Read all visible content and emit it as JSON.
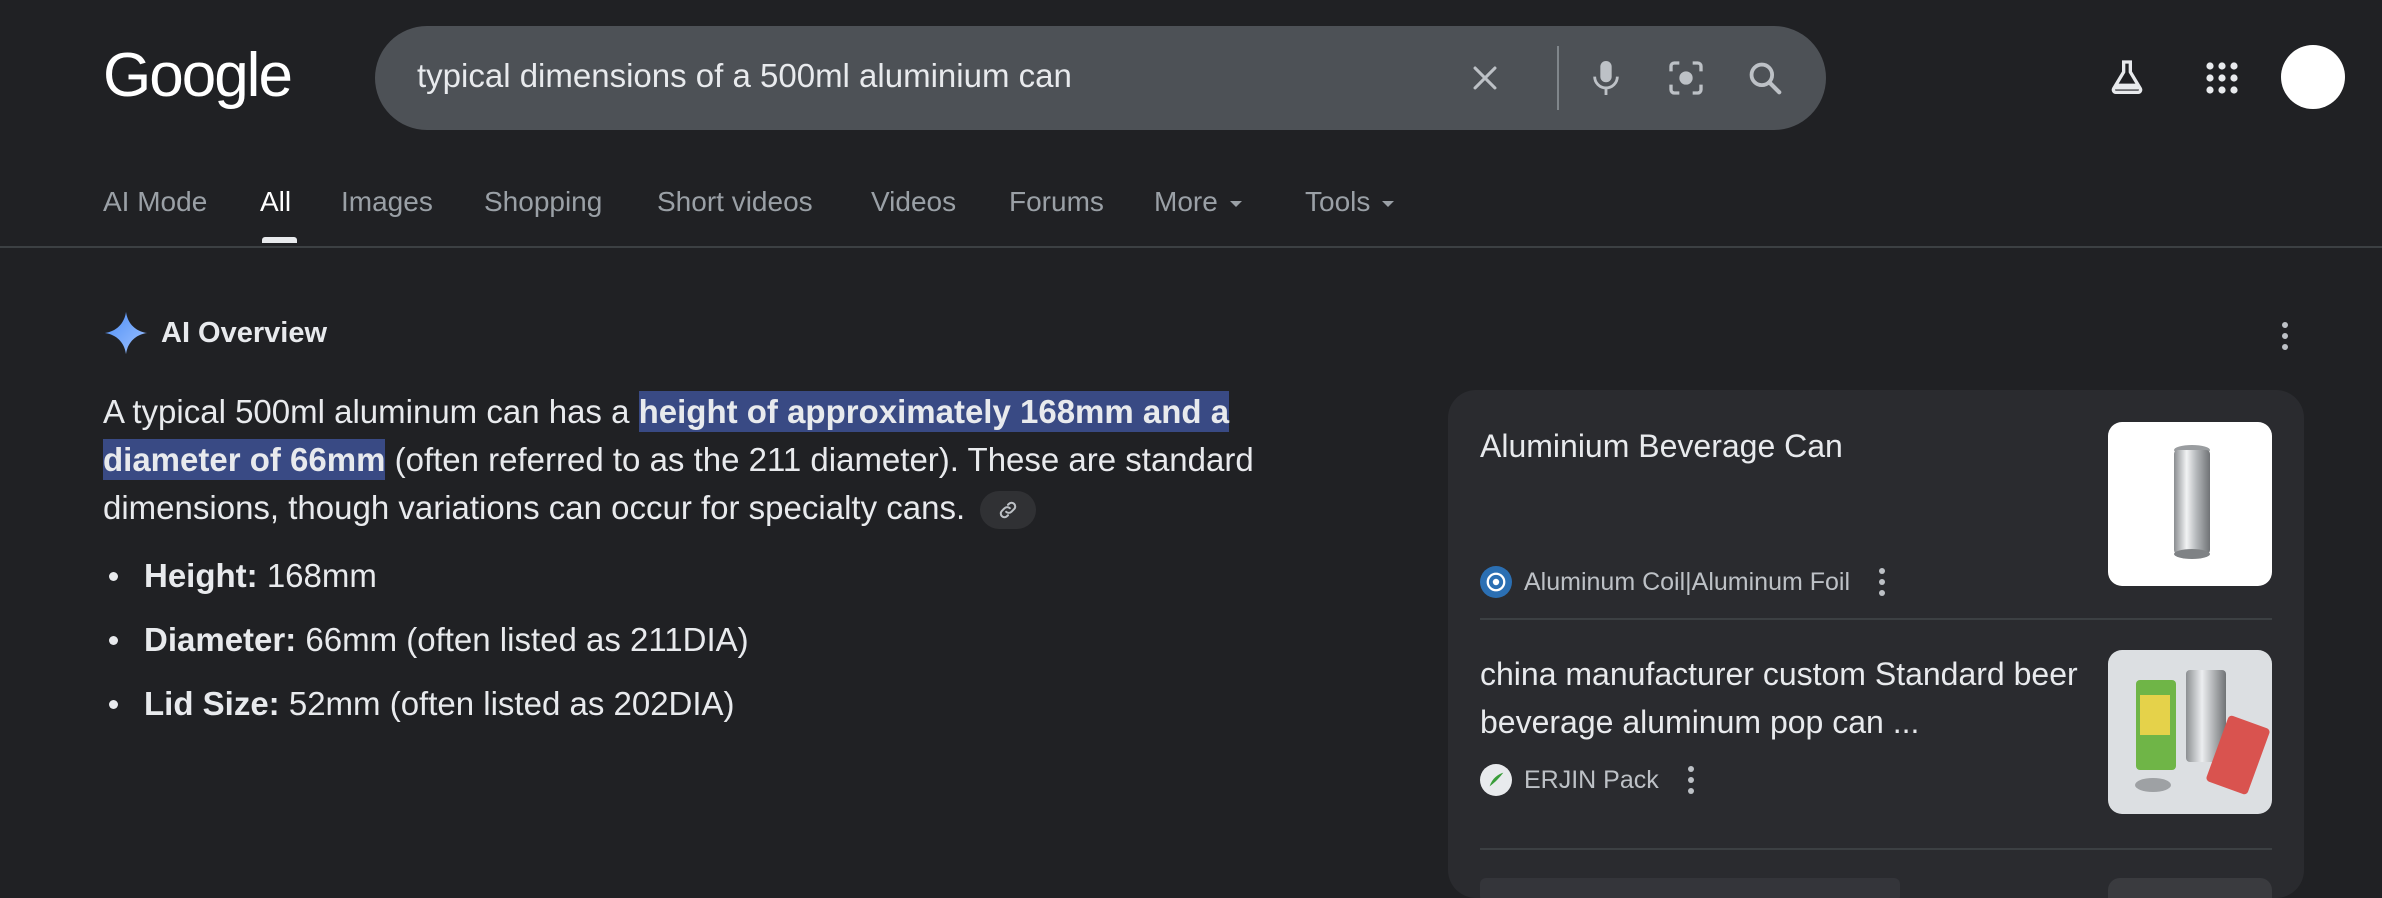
{
  "header": {
    "logo_text": "Google",
    "search": {
      "query": "typical dimensions of a 500ml aluminium can",
      "clear_icon": "close-icon",
      "voice_icon": "mic-icon",
      "lens_icon": "camera-lens-icon",
      "search_icon": "search-icon"
    },
    "labs_icon": "flask-icon",
    "apps_icon": "grid-icon"
  },
  "tabs": [
    {
      "label": "AI Mode"
    },
    {
      "label": "All"
    },
    {
      "label": "Images"
    },
    {
      "label": "Shopping"
    },
    {
      "label": "Short videos"
    },
    {
      "label": "Videos"
    },
    {
      "label": "Forums"
    },
    {
      "label": "More"
    },
    {
      "label": "Tools"
    }
  ],
  "active_tab": "All",
  "ai_overview": {
    "title": "AI Overview",
    "para_before": "A typical 500ml aluminum can has a ",
    "para_highlight": "height of approximately 168mm and a diameter of 66mm",
    "para_after": " (often referred to as the 211 diameter). These are standard dimensions, though variations can occur for specialty cans.",
    "bullets": [
      {
        "label": "Height:",
        "text": " 168mm"
      },
      {
        "label": "Diameter:",
        "text": " 66mm (often listed as 211DIA)"
      },
      {
        "label": "Lid Size:",
        "text": " 52mm (often listed as 202DIA)"
      }
    ]
  },
  "sources": [
    {
      "title": "Aluminium Beverage Can",
      "site": "Aluminum Coil|Aluminum Foil"
    },
    {
      "title": "china manufacturer custom Standard beer beverage aluminum pop can ...",
      "site": "ERJIN Pack"
    }
  ],
  "colors": {
    "background": "#202124",
    "search_bg": "#4d5156",
    "highlight": "#394a84",
    "card_bg": "#2a2b2f"
  }
}
